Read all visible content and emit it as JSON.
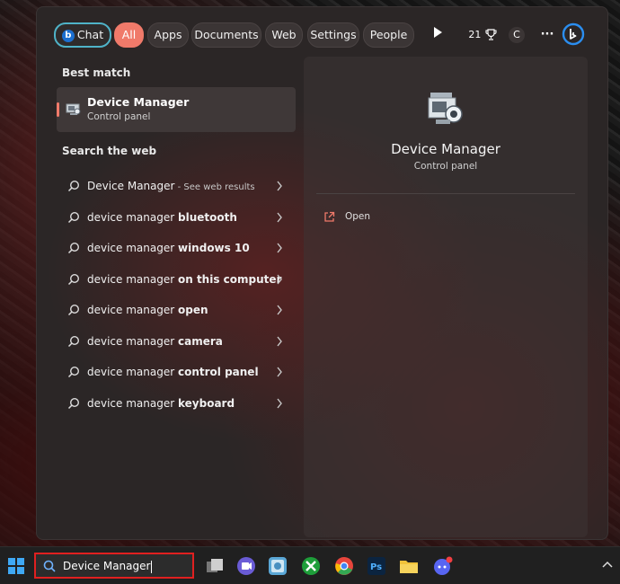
{
  "tabs": [
    {
      "label": "Chat"
    },
    {
      "label": "All"
    },
    {
      "label": "Apps"
    },
    {
      "label": "Documents"
    },
    {
      "label": "Web"
    },
    {
      "label": "Settings"
    },
    {
      "label": "People"
    }
  ],
  "toolbar": {
    "points": "21",
    "avatar_letter": "C",
    "more": "···"
  },
  "left": {
    "best_match_title": "Best match",
    "best_match": {
      "name": "Device Manager",
      "sub": "Control panel"
    },
    "search_web_title": "Search the web",
    "web_results": [
      {
        "normal": "Device Manager",
        "bold": "",
        "see": " - See web results"
      },
      {
        "normal": "device manager ",
        "bold": "bluetooth",
        "see": ""
      },
      {
        "normal": "device manager ",
        "bold": "windows 10",
        "see": ""
      },
      {
        "normal": "device manager ",
        "bold": "on this computer",
        "see": ""
      },
      {
        "normal": "device manager ",
        "bold": "open",
        "see": ""
      },
      {
        "normal": "device manager ",
        "bold": "camera",
        "see": ""
      },
      {
        "normal": "device manager ",
        "bold": "control panel",
        "see": ""
      },
      {
        "normal": "device manager ",
        "bold": "keyboard",
        "see": ""
      }
    ]
  },
  "right": {
    "title": "Device Manager",
    "sub": "Control panel",
    "open_label": "Open"
  },
  "taskbar": {
    "search_value": "Device Manager"
  },
  "colors": {
    "accent": "#f07a6a",
    "chat_border": "#4fb3c8",
    "search_highlight": "#e02020"
  }
}
